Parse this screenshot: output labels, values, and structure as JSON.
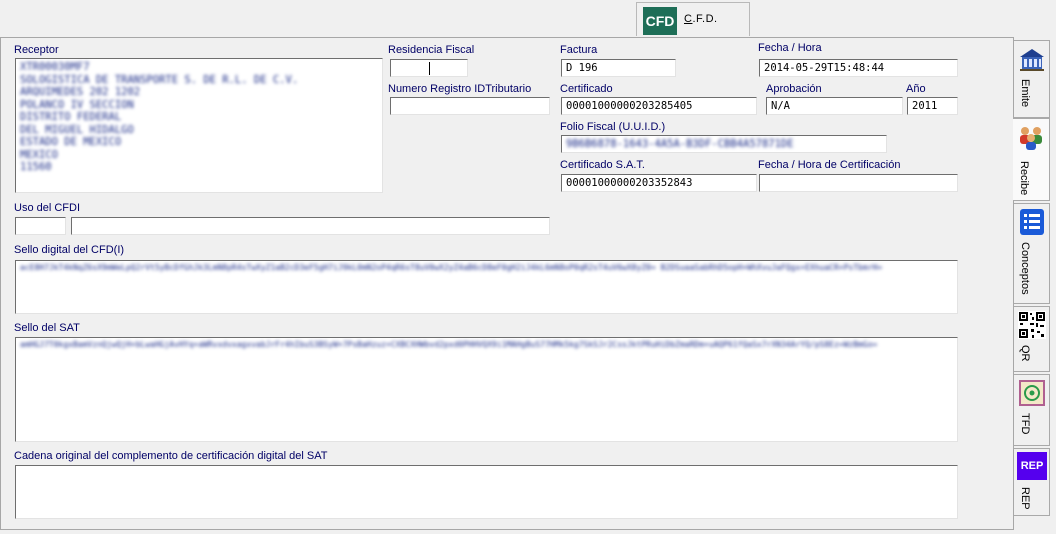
{
  "top_tab": {
    "logo": "CFD",
    "label": "C.F.D.",
    "accel": "C"
  },
  "receptor": {
    "label": "Receptor",
    "lines": [
      "XTR00030MF7",
      "SOLOGISTICA DE TRANSPORTE S. DE R.L. DE C.V.",
      "ARQUIMEDES 202 1202",
      "POLANCO IV SECCION",
      "DISTRITO FEDERAL",
      "DEL MIGUEL HIDALGO",
      "ESTADO DE MEXICO",
      "MEXICO",
      "11560"
    ]
  },
  "residencia": {
    "label": "Residencia Fiscal",
    "value": ""
  },
  "num_registro": {
    "label": "Numero Registro IDTributario",
    "value": ""
  },
  "factura": {
    "label": "Factura",
    "value": "D 196"
  },
  "fecha_hora": {
    "label": "Fecha / Hora",
    "value": "2014-05-29T15:48:44"
  },
  "certificado": {
    "label": "Certificado",
    "value": "00001000000203285405"
  },
  "aprobacion": {
    "label": "Aprobación",
    "value": "N/A"
  },
  "anio": {
    "label": "Año",
    "value": "2011"
  },
  "folio_fiscal": {
    "label": "Folio Fiscal (U.U.I.D.)",
    "value": "9B6B6878-1643-4A5A-B3DF-CBB4A57871DE"
  },
  "cert_sat": {
    "label": "Certificado S.A.T.",
    "value": "00001000000203352843"
  },
  "fecha_cert": {
    "label": "Fecha / Hora de Certificación",
    "value": ""
  },
  "uso_cfdi": {
    "label": "Uso del CFDI",
    "code": "",
    "desc": ""
  },
  "sello_cfd": {
    "label": "Sello digital del CFD(I)",
    "value": "acE8H7JkT4kNqZ6sX9mWeLpQ2rVt5yBcDfGhJk3LmN8pR4sTwXyZ1aB2cD3eF5gH7iJ9kL0mN2oP4qR6sT8uV0wX2yZ4aB6cD8eF0gH2iJ4kL6mN8oP0qR2sT4uV6wX8yZ0= B2DSuaaSabRhD5opH+WhXvuJaFQgx+EXhuaCR+PsTbmrH="
  },
  "sello_sat": {
    "label": "Sello del SAT",
    "value": "amHGJ7T0kgxBamVznQjwQjH+bLwaHGjAvHYq+aWRvxdvxagxvabJrFr4hIbuS3BSyW+7PsBaHzuz+CXBCXHWbvd2pxd0PHHVQX9i1MAHgBuS77HMk5kg7SkSJr2CssJktPRuHiDbZmaRDm+uAQP61fQaSx7rXN34ArYQ/pS8Ez=WzBmGo="
  },
  "cadena": {
    "label": "Cadena original del complemento de certificación digital del SAT",
    "value": ""
  },
  "side_tabs": [
    {
      "label": "Emite",
      "icon": "building-icon"
    },
    {
      "label": "Recibe",
      "icon": "people-icon"
    },
    {
      "label": "Conceptos",
      "icon": "list-icon"
    },
    {
      "label": "QR",
      "icon": "qr-code-icon"
    },
    {
      "label": "TFD",
      "icon": "stamp-icon"
    },
    {
      "label": "REP",
      "icon": "rep-icon",
      "badge": "REP"
    }
  ],
  "colors": {
    "accent_green": "#1e6e57",
    "rep_purple": "#5500ee",
    "label_blue": "#000066"
  }
}
